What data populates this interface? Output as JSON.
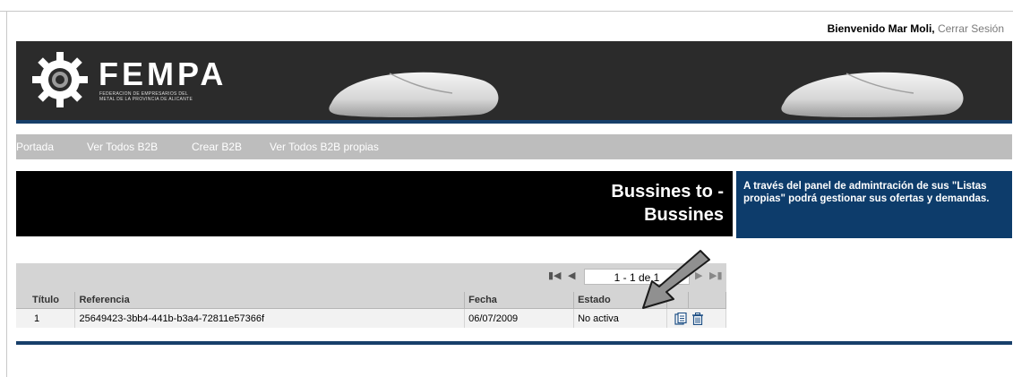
{
  "header": {
    "welcome_text": "Bienvenido Mar Moli,",
    "logout_label": "Cerrar Sesión"
  },
  "logo": {
    "name": "FEMPA",
    "subtitle_line1": "FEDERACION DE EMPRESARIOS DEL",
    "subtitle_line2": "METAL DE LA PROVINCIA DE ALICANTE"
  },
  "nav": {
    "items": [
      {
        "label": "Portada"
      },
      {
        "label": "Ver Todos B2B"
      },
      {
        "label": "Crear B2B"
      },
      {
        "label": "Ver Todos B2B propias"
      }
    ]
  },
  "main": {
    "title_line1": "Bussines to -",
    "title_line2": "Bussines"
  },
  "info": {
    "text": "A través del panel de admintración de sus \"Listas propias\" podrá gestionar sus ofertas y demandas."
  },
  "pager": {
    "value": "1 - 1 de 1"
  },
  "table": {
    "columns": [
      "Título",
      "Referencia",
      "Fecha",
      "Estado",
      "",
      ""
    ],
    "rows": [
      {
        "titulo": "1",
        "referencia": "25649423-3bb4-441b-b3a4-72811e57366f",
        "fecha": "06/07/2009",
        "estado": "No activa"
      }
    ]
  },
  "colors": {
    "banner": "#2b2b2b",
    "accent_blue": "#0d3c6b",
    "nav_grey": "#bdbdbd"
  }
}
